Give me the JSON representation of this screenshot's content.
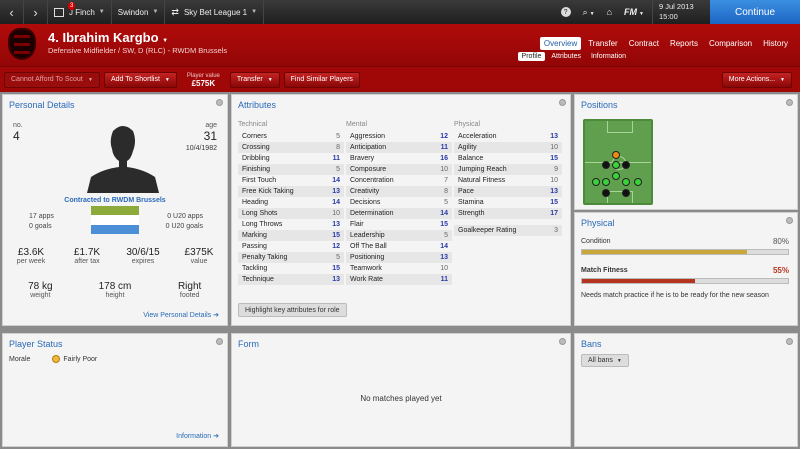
{
  "topbar": {
    "back": "‹",
    "forward": "›",
    "inbox_count": "3",
    "manager": "J Finch",
    "club": "Swindon",
    "competition": "Sky Bet League 1",
    "date_line1": "9 Jul 2013",
    "date_line2": "15:00",
    "continue_label": "Continue",
    "help": "?",
    "fm_label": "FM"
  },
  "header": {
    "player_name": "4. Ibrahim Kargbo",
    "subtitle": "Defensive Midfielder / SW, D (RLC) - RWDM Brussels",
    "tabs": [
      {
        "label": "Overview",
        "active": true
      },
      {
        "label": "Transfer"
      },
      {
        "label": "Contract"
      },
      {
        "label": "Reports"
      },
      {
        "label": "Comparison"
      },
      {
        "label": "History"
      }
    ],
    "subtabs": [
      {
        "label": "Profile",
        "active": true
      },
      {
        "label": "Attributes"
      },
      {
        "label": "Information"
      }
    ]
  },
  "actionbar": {
    "scout_label": "Cannot Afford To Scout",
    "shortlist_label": "Add To Shortlist",
    "player_value_label": "Player value",
    "player_value": "£575K",
    "transfer_label": "Transfer",
    "similar_label": "Find Similar Players",
    "more_actions_label": "More Actions..."
  },
  "personal": {
    "title": "Personal Details",
    "no_label": "no.",
    "no": "4",
    "age_label": "age",
    "age": "31",
    "dob": "10/4/1982",
    "contract": "Contracted to RWDM Brussels",
    "apps_left": "17 apps",
    "goals_left": "0 goals",
    "apps_right": "0 U20 apps",
    "goals_right": "0 U20 goals",
    "wage": "£3.6K",
    "wage_label": "per week",
    "after_tax": "£1.7K",
    "after_tax_label": "after tax",
    "expires": "30/6/15",
    "expires_label": "expires",
    "value": "£375K",
    "value_label": "value",
    "weight": "78 kg",
    "weight_label": "weight",
    "height": "178 cm",
    "height_label": "height",
    "footed": "Right",
    "footed_label": "footed",
    "link": "View Personal Details ➔",
    "flag_colors": [
      "#8dab3a",
      "#ffffff",
      "#4c8fd6"
    ]
  },
  "attributes": {
    "title": "Attributes",
    "technical_label": "Technical",
    "mental_label": "Mental",
    "physical_label": "Physical",
    "technical": [
      {
        "name": "Corners",
        "value": "5"
      },
      {
        "name": "Crossing",
        "value": "8"
      },
      {
        "name": "Dribbling",
        "value": "11"
      },
      {
        "name": "Finishing",
        "value": "5"
      },
      {
        "name": "First Touch",
        "value": "14"
      },
      {
        "name": "Free Kick Taking",
        "value": "13"
      },
      {
        "name": "Heading",
        "value": "14"
      },
      {
        "name": "Long Shots",
        "value": "10"
      },
      {
        "name": "Long Throws",
        "value": "13"
      },
      {
        "name": "Marking",
        "value": "15"
      },
      {
        "name": "Passing",
        "value": "12"
      },
      {
        "name": "Penalty Taking",
        "value": "5"
      },
      {
        "name": "Tackling",
        "value": "15"
      },
      {
        "name": "Technique",
        "value": "13"
      }
    ],
    "mental": [
      {
        "name": "Aggression",
        "value": "12"
      },
      {
        "name": "Anticipation",
        "value": "11"
      },
      {
        "name": "Bravery",
        "value": "16"
      },
      {
        "name": "Composure",
        "value": "10"
      },
      {
        "name": "Concentration",
        "value": "7"
      },
      {
        "name": "Creativity",
        "value": "8"
      },
      {
        "name": "Decisions",
        "value": "5"
      },
      {
        "name": "Determination",
        "value": "14"
      },
      {
        "name": "Flair",
        "value": "15"
      },
      {
        "name": "Leadership",
        "value": "5"
      },
      {
        "name": "Off The Ball",
        "value": "14"
      },
      {
        "name": "Positioning",
        "value": "13"
      },
      {
        "name": "Teamwork",
        "value": "10"
      },
      {
        "name": "Work Rate",
        "value": "11"
      }
    ],
    "physical": [
      {
        "name": "Acceleration",
        "value": "13"
      },
      {
        "name": "Agility",
        "value": "10"
      },
      {
        "name": "Balance",
        "value": "15"
      },
      {
        "name": "Jumping Reach",
        "value": "9"
      },
      {
        "name": "Natural Fitness",
        "value": "10"
      },
      {
        "name": "Pace",
        "value": "13"
      },
      {
        "name": "Stamina",
        "value": "15"
      },
      {
        "name": "Strength",
        "value": "17"
      }
    ],
    "goalkeeper_label": "Goalkeeper Rating",
    "goalkeeper_value": "3",
    "highlight_label": "Highlight key attributes for role"
  },
  "positions": {
    "title": "Positions"
  },
  "physical": {
    "title": "Physical",
    "condition_label": "Condition",
    "condition_value": "80%",
    "condition_fraction": 0.8,
    "fitness_label": "Match Fitness",
    "fitness_value": "55%",
    "fitness_fraction": 0.55,
    "note": "Needs match practice if he is to be ready for the new season",
    "condition_color": "#c9a73a",
    "fitness_color": "#b5341f"
  },
  "status": {
    "title": "Player Status",
    "morale_label": "Morale",
    "morale_value": "Fairly Poor",
    "link": "Information ➔"
  },
  "form": {
    "title": "Form",
    "empty": "No matches played yet"
  },
  "bans": {
    "title": "Bans",
    "filter": "All bans"
  }
}
